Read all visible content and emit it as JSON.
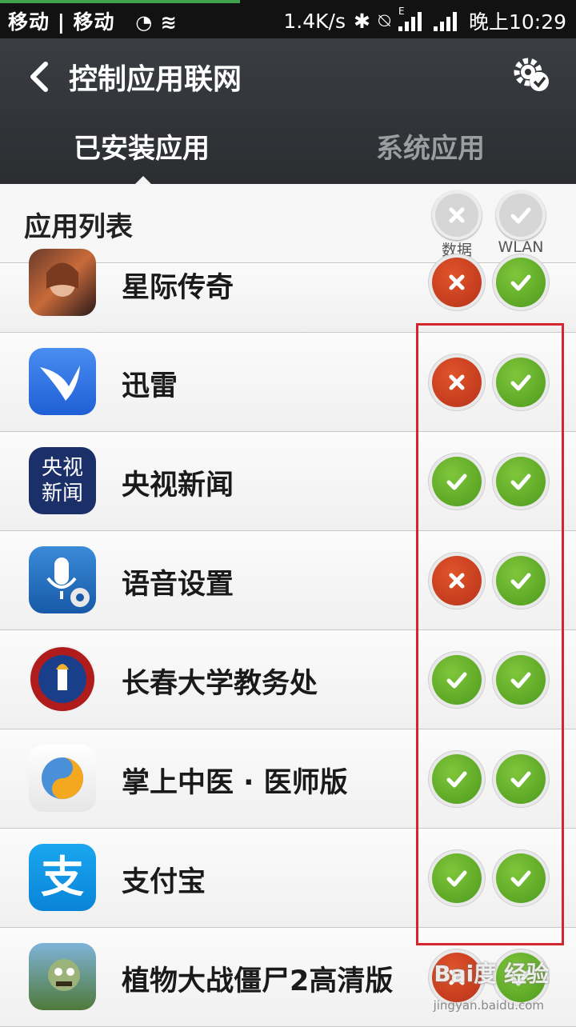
{
  "status_bar": {
    "carriers": "移动 | 移动",
    "net_speed": "1.4K/s",
    "net_type": "E",
    "time": "晚上10:29"
  },
  "header": {
    "title": "控制应用联网",
    "tabs": [
      {
        "label": "已安装应用",
        "active": true
      },
      {
        "label": "系统应用",
        "active": false
      }
    ]
  },
  "list_header": {
    "label": "应用列表",
    "data_caption": "数据",
    "wlan_caption": "WLAN"
  },
  "apps": [
    {
      "name": "星际传奇",
      "data": false,
      "wlan": true
    },
    {
      "name": "迅雷",
      "data": false,
      "wlan": true
    },
    {
      "name": "央视新闻",
      "data": true,
      "wlan": true,
      "icon_text": [
        "央视",
        "新闻"
      ]
    },
    {
      "name": "语音设置",
      "data": false,
      "wlan": true
    },
    {
      "name": "长春大学教务处",
      "data": true,
      "wlan": true
    },
    {
      "name": "掌上中医 · 医师版",
      "data": true,
      "wlan": true
    },
    {
      "name": "支付宝",
      "data": true,
      "wlan": true,
      "icon_text": [
        "支"
      ]
    },
    {
      "name": "植物大战僵尸2高清版",
      "data": false,
      "wlan": true
    }
  ],
  "watermark": {
    "text": "Bai度 经验",
    "url": "jingyan.baidu.com"
  },
  "colors": {
    "on": "#5aa82a",
    "off": "#c93a1f",
    "header_bg": "#2f3136",
    "highlight_box": "#d3262f"
  }
}
